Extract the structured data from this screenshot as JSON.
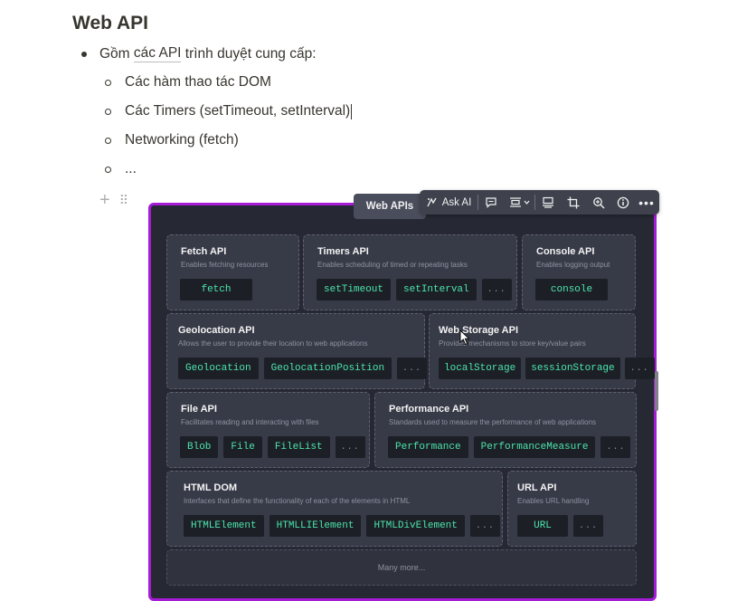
{
  "doc": {
    "title": "Web API",
    "bullet": {
      "prefix": "Gồm ",
      "link": "các API",
      "suffix": " trình duyệt cung cấp:"
    },
    "subitems": [
      "Các hàm thao tác DOM",
      "Các Timers (setTimeout, setInterval)",
      "Networking (fetch)",
      "..."
    ]
  },
  "gutter": {
    "add_icon": "plus-icon",
    "drag_icon": "drag-handle-icon"
  },
  "image": {
    "tab_label": "Web APIs",
    "toolbar": {
      "ask_ai_label": "Ask AI",
      "icons": [
        "ai-sparkle-icon",
        "comment-icon",
        "align-icon",
        "chevron-down-icon",
        "caption-icon",
        "crop-icon",
        "zoom-icon",
        "info-icon",
        "more-icon"
      ]
    },
    "accent_color": "#a51bd6",
    "cards": [
      {
        "title": "Fetch API",
        "desc": "Enables fetching resources",
        "chips": [
          "fetch"
        ]
      },
      {
        "title": "Timers API",
        "desc": "Enables scheduling of timed or repeating tasks",
        "chips": [
          "setTimeout",
          "setInterval",
          "..."
        ]
      },
      {
        "title": "Console API",
        "desc": "Enables logging output",
        "chips": [
          "console"
        ]
      },
      {
        "title": "Geolocation API",
        "desc": "Allows the user to provide their location to web applications",
        "chips": [
          "Geolocation",
          "GeolocationPosition",
          "..."
        ]
      },
      {
        "title": "Web Storage API",
        "desc": "Provides mechanisms to store key/value pairs",
        "chips": [
          "localStorage",
          "sessionStorage",
          "..."
        ]
      },
      {
        "title": "File API",
        "desc": "Facilitates reading and interacting with files",
        "chips": [
          "Blob",
          "File",
          "FileList",
          "..."
        ]
      },
      {
        "title": "Performance API",
        "desc": "Standards used to measure the performance of web applications",
        "chips": [
          "Performance",
          "PerformanceMeasure",
          "..."
        ]
      },
      {
        "title": "HTML DOM",
        "desc": "Interfaces that define the functionality of each of the elements in HTML",
        "chips": [
          "HTMLElement",
          "HTMLLIElement",
          "HTMLDivElement",
          "..."
        ]
      },
      {
        "title": "URL API",
        "desc": "Enables URL handling",
        "chips": [
          "URL",
          "..."
        ]
      }
    ],
    "many_more": "Many more..."
  }
}
